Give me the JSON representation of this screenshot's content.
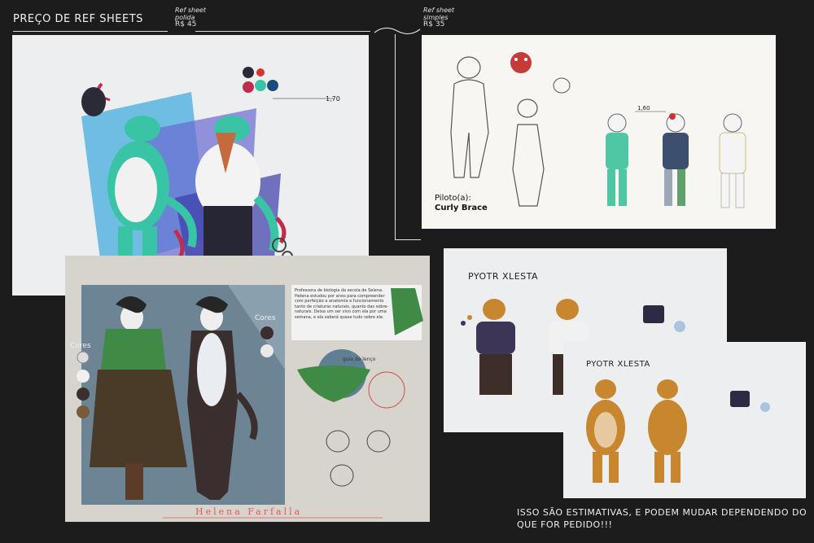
{
  "header": {
    "title": "PREÇO DE REF SHEETS",
    "price_polished": {
      "line1": "Ref sheet",
      "line2": "polida",
      "line3": "R$ 45"
    },
    "price_simple": {
      "line1": "Ref sheet",
      "line2": "simples",
      "line3": "R$ 35"
    }
  },
  "sheets": {
    "dragon": {
      "height_mark": "1,70"
    },
    "curly": {
      "label_line1": "Piloto(a):",
      "label_line2": "Curly Brace",
      "height_mark": "1,60"
    },
    "helena": {
      "notes": "Professora de biologia da escola de Selena. Helena estudou por anos para compreender com perfeição a anatomia e funcionamento tanto de criaturas naturais, quanto das sobre-naturais. Deixa um ser vivo com ela por uma semana, e ela saberá quase tudo sobre ele.",
      "colors_label": "Cores",
      "colors_label2": "Cores",
      "scarf_label": "guia do lenço",
      "name": "Helena Farfalla"
    },
    "pyotr": {
      "name": "PYOTR XLESTA",
      "name2": "PYOTR XLESTA"
    }
  },
  "footer": {
    "caption": "ISSO SÃO ESTIMATIVAS, E PODEM MUDAR DEPENDENDO DO QUE FOR PEDIDO!!!"
  },
  "colors": {
    "background": "#1c1c1d",
    "teal": "#39c4a6",
    "helena_green": "#3f8a44",
    "tiger_orange": "#c8862f"
  }
}
